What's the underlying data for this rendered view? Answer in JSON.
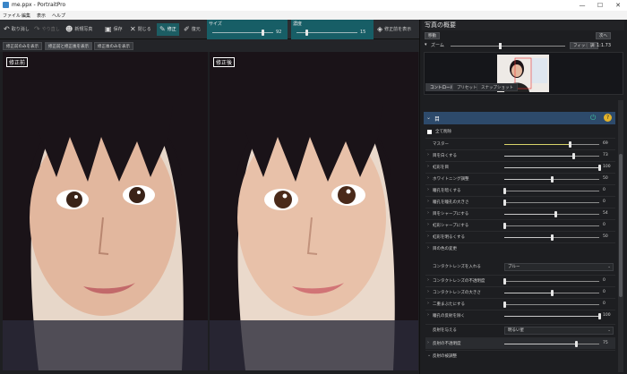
{
  "window": {
    "title": "me.ppx - PortraitPro"
  },
  "menu": [
    "ファイル",
    "編集",
    "表示",
    "ヘルプ"
  ],
  "toolbar": {
    "undo": "取り消し",
    "redo": "やり直し",
    "new_project": "新規写真",
    "save": "保存",
    "close": "閉じる",
    "edit": "修正",
    "restore": "復元",
    "size_label": "サイズ",
    "size_value": "92",
    "strength_label": "濃度",
    "strength_value": "15",
    "layers": "修正前を表示"
  },
  "viewmodes": [
    "修正前のみを表示",
    "修正前と修正後を表示",
    "修正後のみを表示"
  ],
  "photos": {
    "before_label": "修正前",
    "after_label": "修正後"
  },
  "overview": {
    "title": "写真の概要",
    "pan_button": "移動",
    "toggle": "次へ",
    "zoom_label": "ズーム",
    "fit_button": "フィット",
    "all_button": "調",
    "zoom_ratio": "1:1.73"
  },
  "tabs": [
    "コントロール",
    "プリセット",
    "スナップショット"
  ],
  "section": {
    "title": "目",
    "reset_label": "全て削除"
  },
  "master": {
    "label": "マスター",
    "value": "69",
    "level": 0.69
  },
  "sliders": [
    {
      "label": "目を白くする",
      "value": "73",
      "level": 0.73
    },
    {
      "label": "虹彩を目",
      "value": "100",
      "level": 1.0
    },
    {
      "label": "ホワイトニング調整",
      "value": "50",
      "level": 0.5
    },
    {
      "label": "瞳孔を暗くする",
      "value": "0",
      "level": 0.0
    },
    {
      "label": "瞳孔を瞳孔の大きさ",
      "value": "0",
      "level": 0.0
    },
    {
      "label": "目をシャープにする",
      "value": "54",
      "level": 0.54
    },
    {
      "label": "虹彩シャープにする",
      "value": "0",
      "level": 0.0
    },
    {
      "label": "虹彩を明るくする",
      "value": "50",
      "level": 0.5
    }
  ],
  "eye_color": {
    "label": "目の色の変更"
  },
  "lens": {
    "label": "コンタクトレンズを入れる",
    "option": "ブルー"
  },
  "lens_sliders": [
    {
      "label": "コンタクトレンズの不透明度",
      "value": "0",
      "level": 0.0
    },
    {
      "label": "コンタクトレンズの大きさ",
      "value": "0",
      "level": 0.5
    },
    {
      "label": "二重まぶたにする",
      "value": "0",
      "level": 0.0
    },
    {
      "label": "瞳孔の反射を除く",
      "value": "100",
      "level": 1.0
    }
  ],
  "reflection": {
    "label": "反射を与える",
    "option": "明るい星"
  },
  "reflection_opacity": {
    "label": "反射の不透明度",
    "value": "75",
    "level": 0.75
  },
  "footer": {
    "label": "反射の被調整"
  },
  "colors": {
    "accent": "#1c5d63",
    "slider_highlight": "#d8d36a"
  }
}
